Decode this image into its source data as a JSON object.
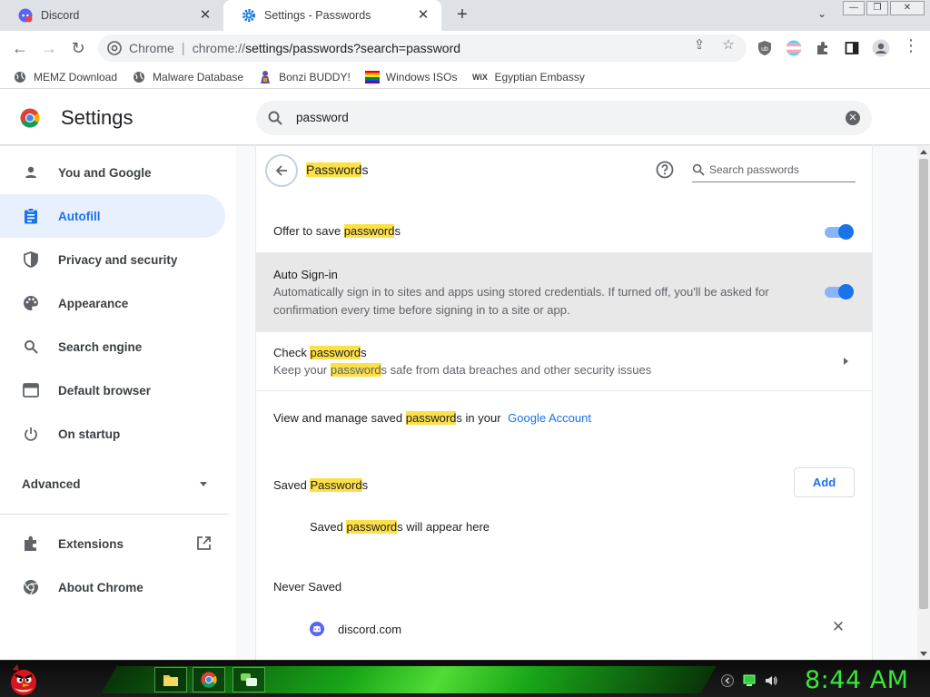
{
  "tabs": [
    {
      "title": "Discord",
      "active": false
    },
    {
      "title": "Settings - Passwords",
      "active": true
    }
  ],
  "toolbar": {
    "omnibox_chip": "Chrome",
    "url_scheme": "chrome://",
    "url_rest": "settings/passwords?search=password"
  },
  "bookmarks": [
    {
      "label": "MEMZ Download",
      "icon": "globe-icon"
    },
    {
      "label": "Malware Database",
      "icon": "globe-icon"
    },
    {
      "label": "Bonzi BUDDY!",
      "icon": "bonzi-icon"
    },
    {
      "label": "Windows ISOs",
      "icon": "windows-flag-icon"
    },
    {
      "label": "Egyptian Embassy",
      "icon": "wix-icon"
    }
  ],
  "header": {
    "title": "Settings",
    "search_value": "password"
  },
  "sidebar": {
    "items": [
      {
        "label": "You and Google",
        "icon": "person-icon"
      },
      {
        "label": "Autofill",
        "icon": "clipboard-icon",
        "active": true
      },
      {
        "label": "Privacy and security",
        "icon": "shield-icon"
      },
      {
        "label": "Appearance",
        "icon": "palette-icon"
      },
      {
        "label": "Search engine",
        "icon": "search-icon"
      },
      {
        "label": "Default browser",
        "icon": "browser-icon"
      },
      {
        "label": "On startup",
        "icon": "power-icon"
      }
    ],
    "advanced": "Advanced",
    "extensions": "Extensions",
    "about": "About Chrome"
  },
  "passwords": {
    "title_hl": "Password",
    "title_rest": "s",
    "search_placeholder": "Search passwords",
    "offer": {
      "pre": "Offer to save ",
      "hl": "password",
      "post": "s",
      "enabled": true
    },
    "autosignin": {
      "title": "Auto Sign-in",
      "desc": "Automatically sign in to sites and apps using stored credentials. If turned off, you'll be asked for confirmation every time before signing in to a site or app.",
      "enabled": true
    },
    "check": {
      "pre": "Check ",
      "hl": "password",
      "post": "s",
      "desc_pre": "Keep your ",
      "desc_hl": "password",
      "desc_post": "s safe from data breaches and other security issues"
    },
    "manage": {
      "pre": "View and manage saved ",
      "hl": "password",
      "post": "s in your",
      "link": "Google Account"
    },
    "saved": {
      "pre": "Saved ",
      "hl": "Password",
      "post": "s",
      "add": "Add"
    },
    "saved_empty": {
      "pre": "Saved ",
      "hl": "password",
      "post": "s will appear here"
    },
    "never_saved": {
      "title": "Never Saved",
      "sites": [
        "discord.com"
      ]
    }
  },
  "taskbar": {
    "clock": "8:44 AM"
  },
  "colors": {
    "accent": "#1a73e8",
    "highlight": "#fde047",
    "clock_green": "#39e639"
  }
}
